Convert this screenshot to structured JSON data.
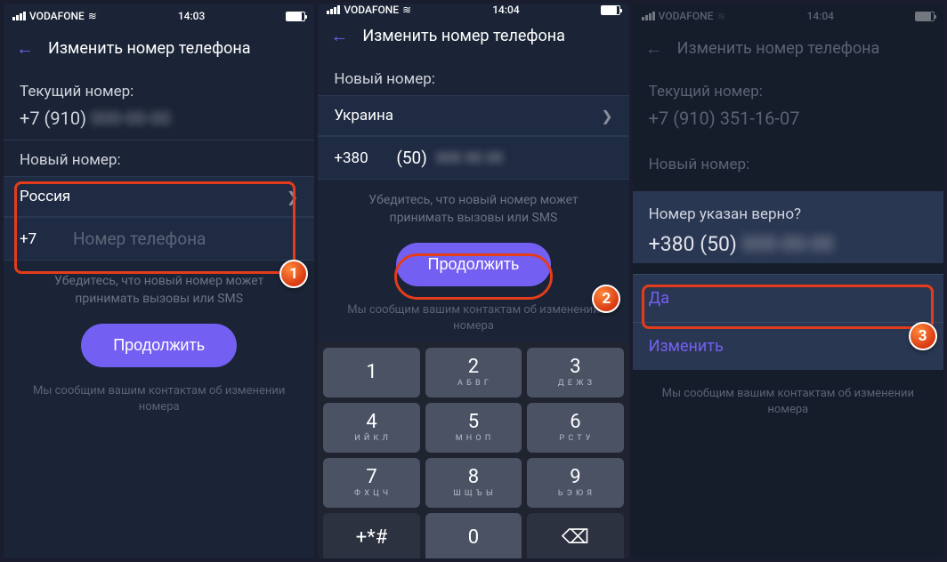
{
  "status": {
    "carrier": "VODAFONE",
    "time1": "14:03",
    "time2": "14:04"
  },
  "header": {
    "title": "Изменить номер телефона"
  },
  "screen1": {
    "current_label": "Текущий номер:",
    "current_prefix": "+7 (910)",
    "current_rest": "000-00-00",
    "new_label": "Новый номер:",
    "country": "Россия",
    "prefix": "+7",
    "placeholder": "Номер телефона",
    "hint": "Убедитесь, что новый номер может принимать вызовы или SMS",
    "continue": "Продолжить",
    "footer": "Мы сообщим вашим контактам об изменении номера"
  },
  "screen2": {
    "new_label": "Новый номер:",
    "country": "Украина",
    "prefix": "+380",
    "area": "(50)",
    "rest": "000 00 00",
    "hint": "Убедитесь, что новый номер может принимать вызовы или SMS",
    "continue": "Продолжить",
    "footer": "Мы сообщим вашим контактам об изменении номера",
    "keypad": [
      {
        "d": "1",
        "l": ""
      },
      {
        "d": "2",
        "l": "А Б В Г"
      },
      {
        "d": "3",
        "l": "Д Е Ж З"
      },
      {
        "d": "4",
        "l": "И Й К Л"
      },
      {
        "d": "5",
        "l": "М Н О П"
      },
      {
        "d": "6",
        "l": "Р С Т У"
      },
      {
        "d": "7",
        "l": "Ф Х Ц Ч"
      },
      {
        "d": "8",
        "l": "Ш Щ Ъ Ы"
      },
      {
        "d": "9",
        "l": "Ь Э Ю Я"
      },
      {
        "d": "+*#",
        "alt": true
      },
      {
        "d": "0",
        "l": ""
      },
      {
        "d": "⌫",
        "alt": true
      }
    ]
  },
  "screen3": {
    "current_label": "Текущий номер:",
    "current_value": "+7 (910) 351-16-07",
    "new_label": "Новый номер:",
    "question": "Номер указан верно?",
    "confirm_prefix": "+380 (50)",
    "confirm_rest": "000-00-00",
    "yes": "Да",
    "edit": "Изменить",
    "footer": "Мы сообщим вашим контактам об изменении номера"
  }
}
